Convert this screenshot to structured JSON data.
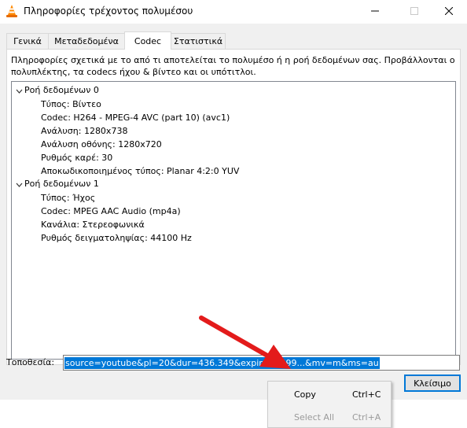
{
  "window": {
    "title": "Πληροφορίες τρέχοντος πολυμέσου",
    "app_icon": "vlc-cone-icon",
    "minimize_icon": "minimize-icon",
    "maximize_icon": "maximize-icon",
    "close_icon": "close-icon"
  },
  "tabs": [
    {
      "label": "Γενικά",
      "active": false
    },
    {
      "label": "Μεταδεδομένα",
      "active": false
    },
    {
      "label": "Codec",
      "active": true
    },
    {
      "label": "Στατιστικά",
      "active": false
    }
  ],
  "codec_panel": {
    "description": "Πληροφορίες σχετικά με το από τι αποτελείται το πολυμέσο ή η ροή δεδομένων σας. Προβάλλονται ο πολυπλέκτης, τα codecs ήχου & βίντεο και οι υπότιτλοι.",
    "streams": [
      {
        "name": "Ροή δεδομένων 0",
        "expanded": true,
        "properties": [
          "Τύπος: Βίντεο",
          "Codec: H264 - MPEG-4 AVC (part 10) (avc1)",
          "Ανάλυση: 1280x738",
          "Ανάλυση οθόνης: 1280x720",
          "Ρυθμός καρέ: 30",
          "Αποκωδικοποιημένος τύπος: Planar 4:2:0 YUV"
        ]
      },
      {
        "name": "Ροή δεδομένων 1",
        "expanded": true,
        "properties": [
          "Τύπος: Ήχος",
          "Codec: MPEG AAC Audio (mp4a)",
          "Κανάλια: Στερεοφωνικά",
          "Ρυθμός δειγματοληψίας: 44100 Hz"
        ]
      }
    ]
  },
  "location": {
    "label": "Τοποθεσία:",
    "value": "source=youtube&pl=20&dur=436.349&expire=1499...&mv=m&ms=au"
  },
  "close_button": {
    "label": "Κλείσιμο"
  },
  "context_menu": {
    "items": [
      {
        "label": "Copy",
        "shortcut": "Ctrl+C",
        "enabled": true
      },
      {
        "label": "Select All",
        "shortcut": "Ctrl+A",
        "enabled": false
      }
    ]
  },
  "colors": {
    "selection": "#0078d7",
    "annotation_arrow": "#e31b1b",
    "client_bg": "#f0f0f0"
  }
}
